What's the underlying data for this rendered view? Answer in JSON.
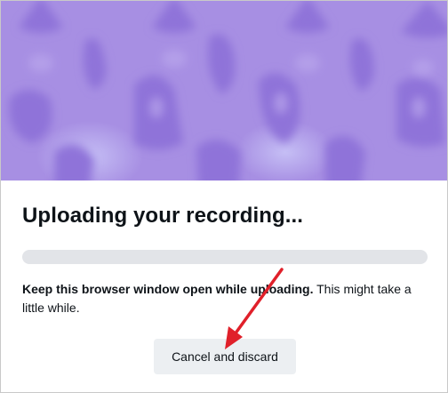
{
  "dialog": {
    "title": "Uploading your recording...",
    "message_bold": "Keep this browser window open while uploading.",
    "message_rest": " This might take a little while.",
    "upload_progress_percent": 0,
    "cancel_label": "Cancel and discard"
  },
  "colors": {
    "hero_background": "#a78fe3",
    "hero_pattern": "#8f73d9",
    "progress_track": "#e2e4e8",
    "button_background": "#eceff2",
    "annotation_arrow": "#e0202a"
  },
  "annotation": {
    "icon": "red-arrow-icon",
    "points_to": "cancel-button"
  }
}
